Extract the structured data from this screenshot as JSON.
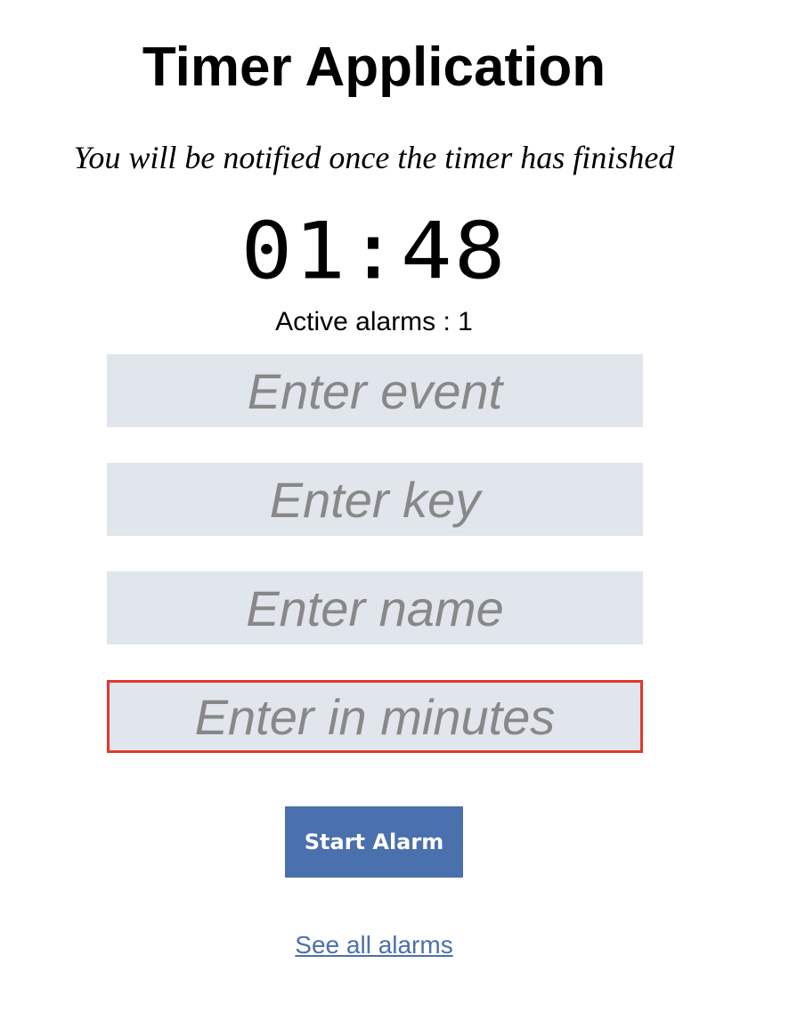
{
  "header": {
    "title": "Timer Application",
    "subtitle": "You will be notified once the timer has finished"
  },
  "timer": {
    "display": "01:48",
    "active_alarms_text": "Active alarms : 1"
  },
  "form": {
    "event_placeholder": "Enter event",
    "key_placeholder": "Enter key",
    "name_placeholder": "Enter name",
    "minutes_placeholder": "Enter in minutes",
    "start_label": "Start Alarm"
  },
  "links": {
    "see_all": "See all alarms"
  },
  "colors": {
    "button_bg": "#4a70ad",
    "input_bg": "#e1e5ec",
    "focus_border": "#e0392b",
    "link": "#4a70ad"
  }
}
